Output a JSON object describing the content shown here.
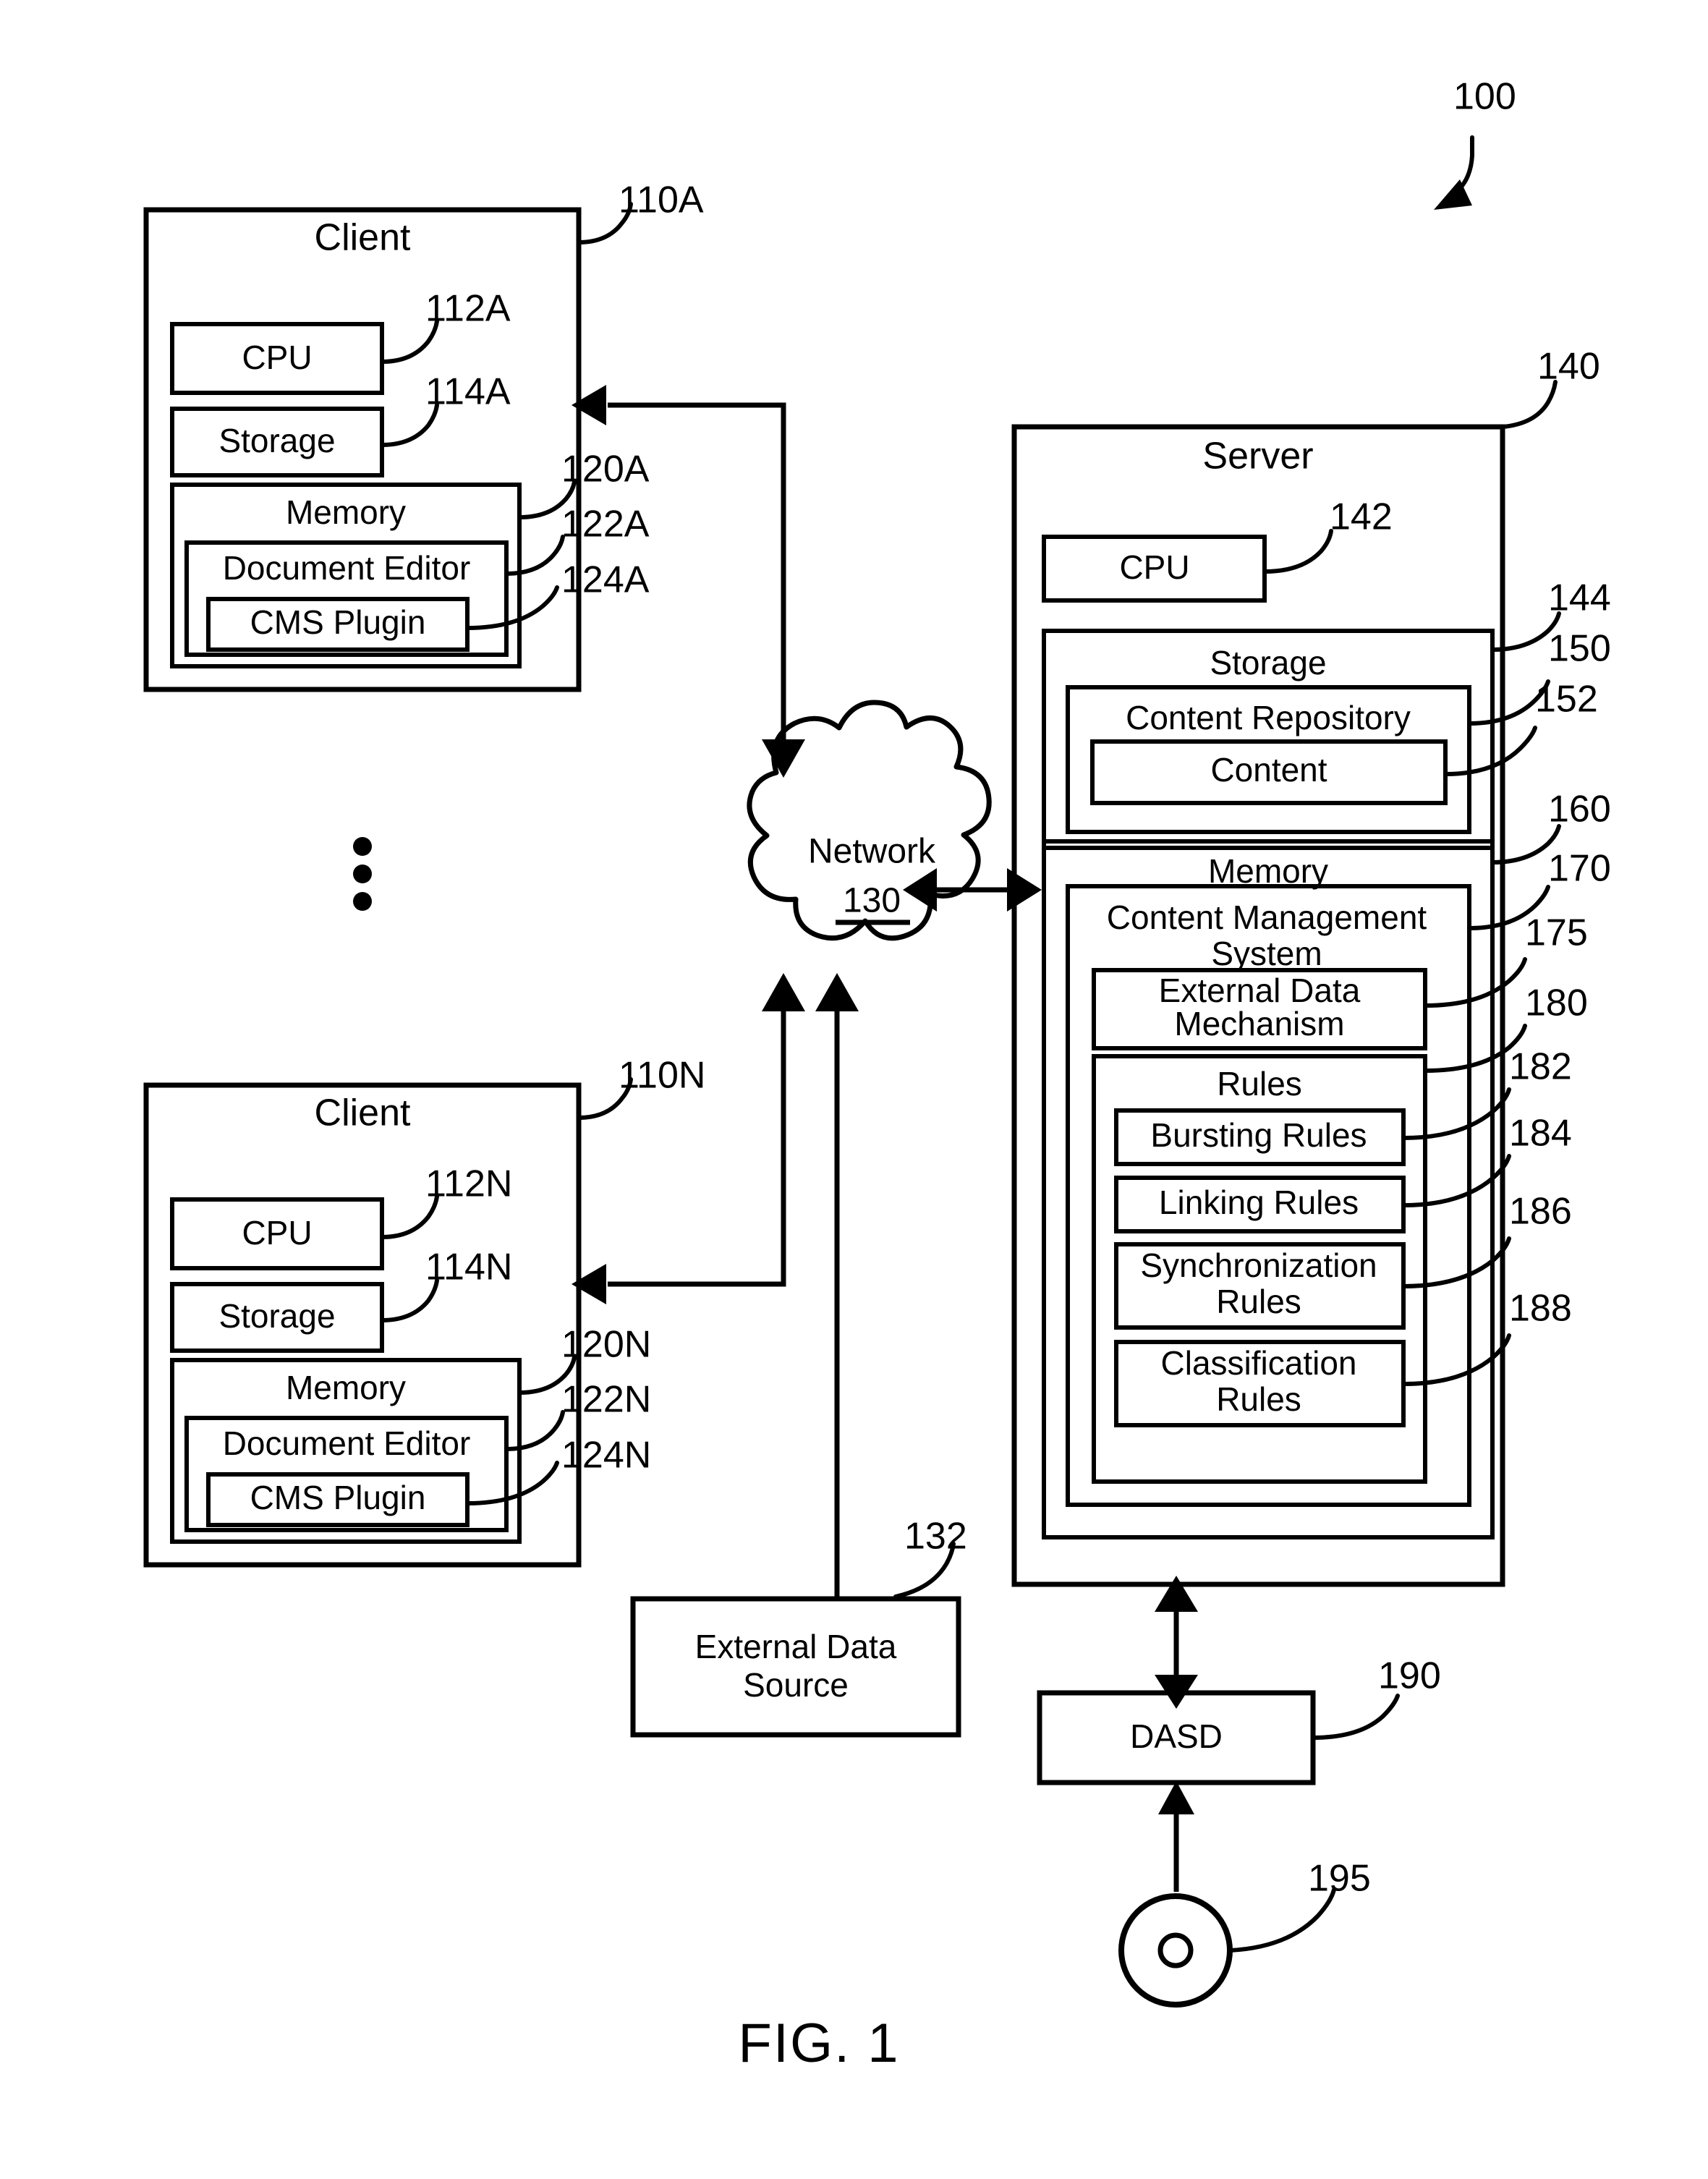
{
  "figure": {
    "caption": "FIG. 1",
    "system_ref": "100"
  },
  "clients": [
    {
      "title": "Client",
      "ref": "110A",
      "cpu": {
        "label": "CPU",
        "ref": "112A"
      },
      "storage": {
        "label": "Storage",
        "ref": "114A"
      },
      "memory": {
        "label": "Memory",
        "ref": "120A"
      },
      "document_editor": {
        "label": "Document Editor",
        "ref": "122A"
      },
      "cms_plugin": {
        "label": "CMS Plugin",
        "ref": "124A"
      }
    },
    {
      "title": "Client",
      "ref": "110N",
      "cpu": {
        "label": "CPU",
        "ref": "112N"
      },
      "storage": {
        "label": "Storage",
        "ref": "114N"
      },
      "memory": {
        "label": "Memory",
        "ref": "120N"
      },
      "document_editor": {
        "label": "Document Editor",
        "ref": "122N"
      },
      "cms_plugin": {
        "label": "CMS Plugin",
        "ref": "124N"
      }
    }
  ],
  "network": {
    "label": "Network",
    "ref": "130"
  },
  "external_data_source": {
    "label_line1": "External Data",
    "label_line2": "Source",
    "ref": "132"
  },
  "server": {
    "title": "Server",
    "ref": "140",
    "cpu": {
      "label": "CPU",
      "ref": "142"
    },
    "storage": {
      "label": "Storage",
      "ref": "144"
    },
    "content_repository": {
      "label": "Content Repository",
      "ref": "150"
    },
    "content": {
      "label": "Content",
      "ref": "152"
    },
    "memory": {
      "label": "Memory",
      "ref": "160"
    },
    "cms": {
      "label_line1": "Content Management",
      "label_line2": "System",
      "ref": "170"
    },
    "external_data_mechanism": {
      "label_line1": "External Data",
      "label_line2": "Mechanism",
      "ref": "175"
    },
    "rules": {
      "label": "Rules",
      "ref": "180"
    },
    "bursting_rules": {
      "label": "Bursting Rules",
      "ref": "182"
    },
    "linking_rules": {
      "label": "Linking Rules",
      "ref": "184"
    },
    "synchronization_rules": {
      "label_line1": "Synchronization",
      "label_line2": "Rules",
      "ref": "186"
    },
    "classification_rules": {
      "label_line1": "Classification",
      "label_line2": "Rules",
      "ref": "188"
    }
  },
  "dasd": {
    "label": "DASD",
    "ref": "190"
  },
  "media": {
    "ref": "195"
  },
  "colors": {
    "ink": "#000000",
    "paper": "#ffffff"
  }
}
